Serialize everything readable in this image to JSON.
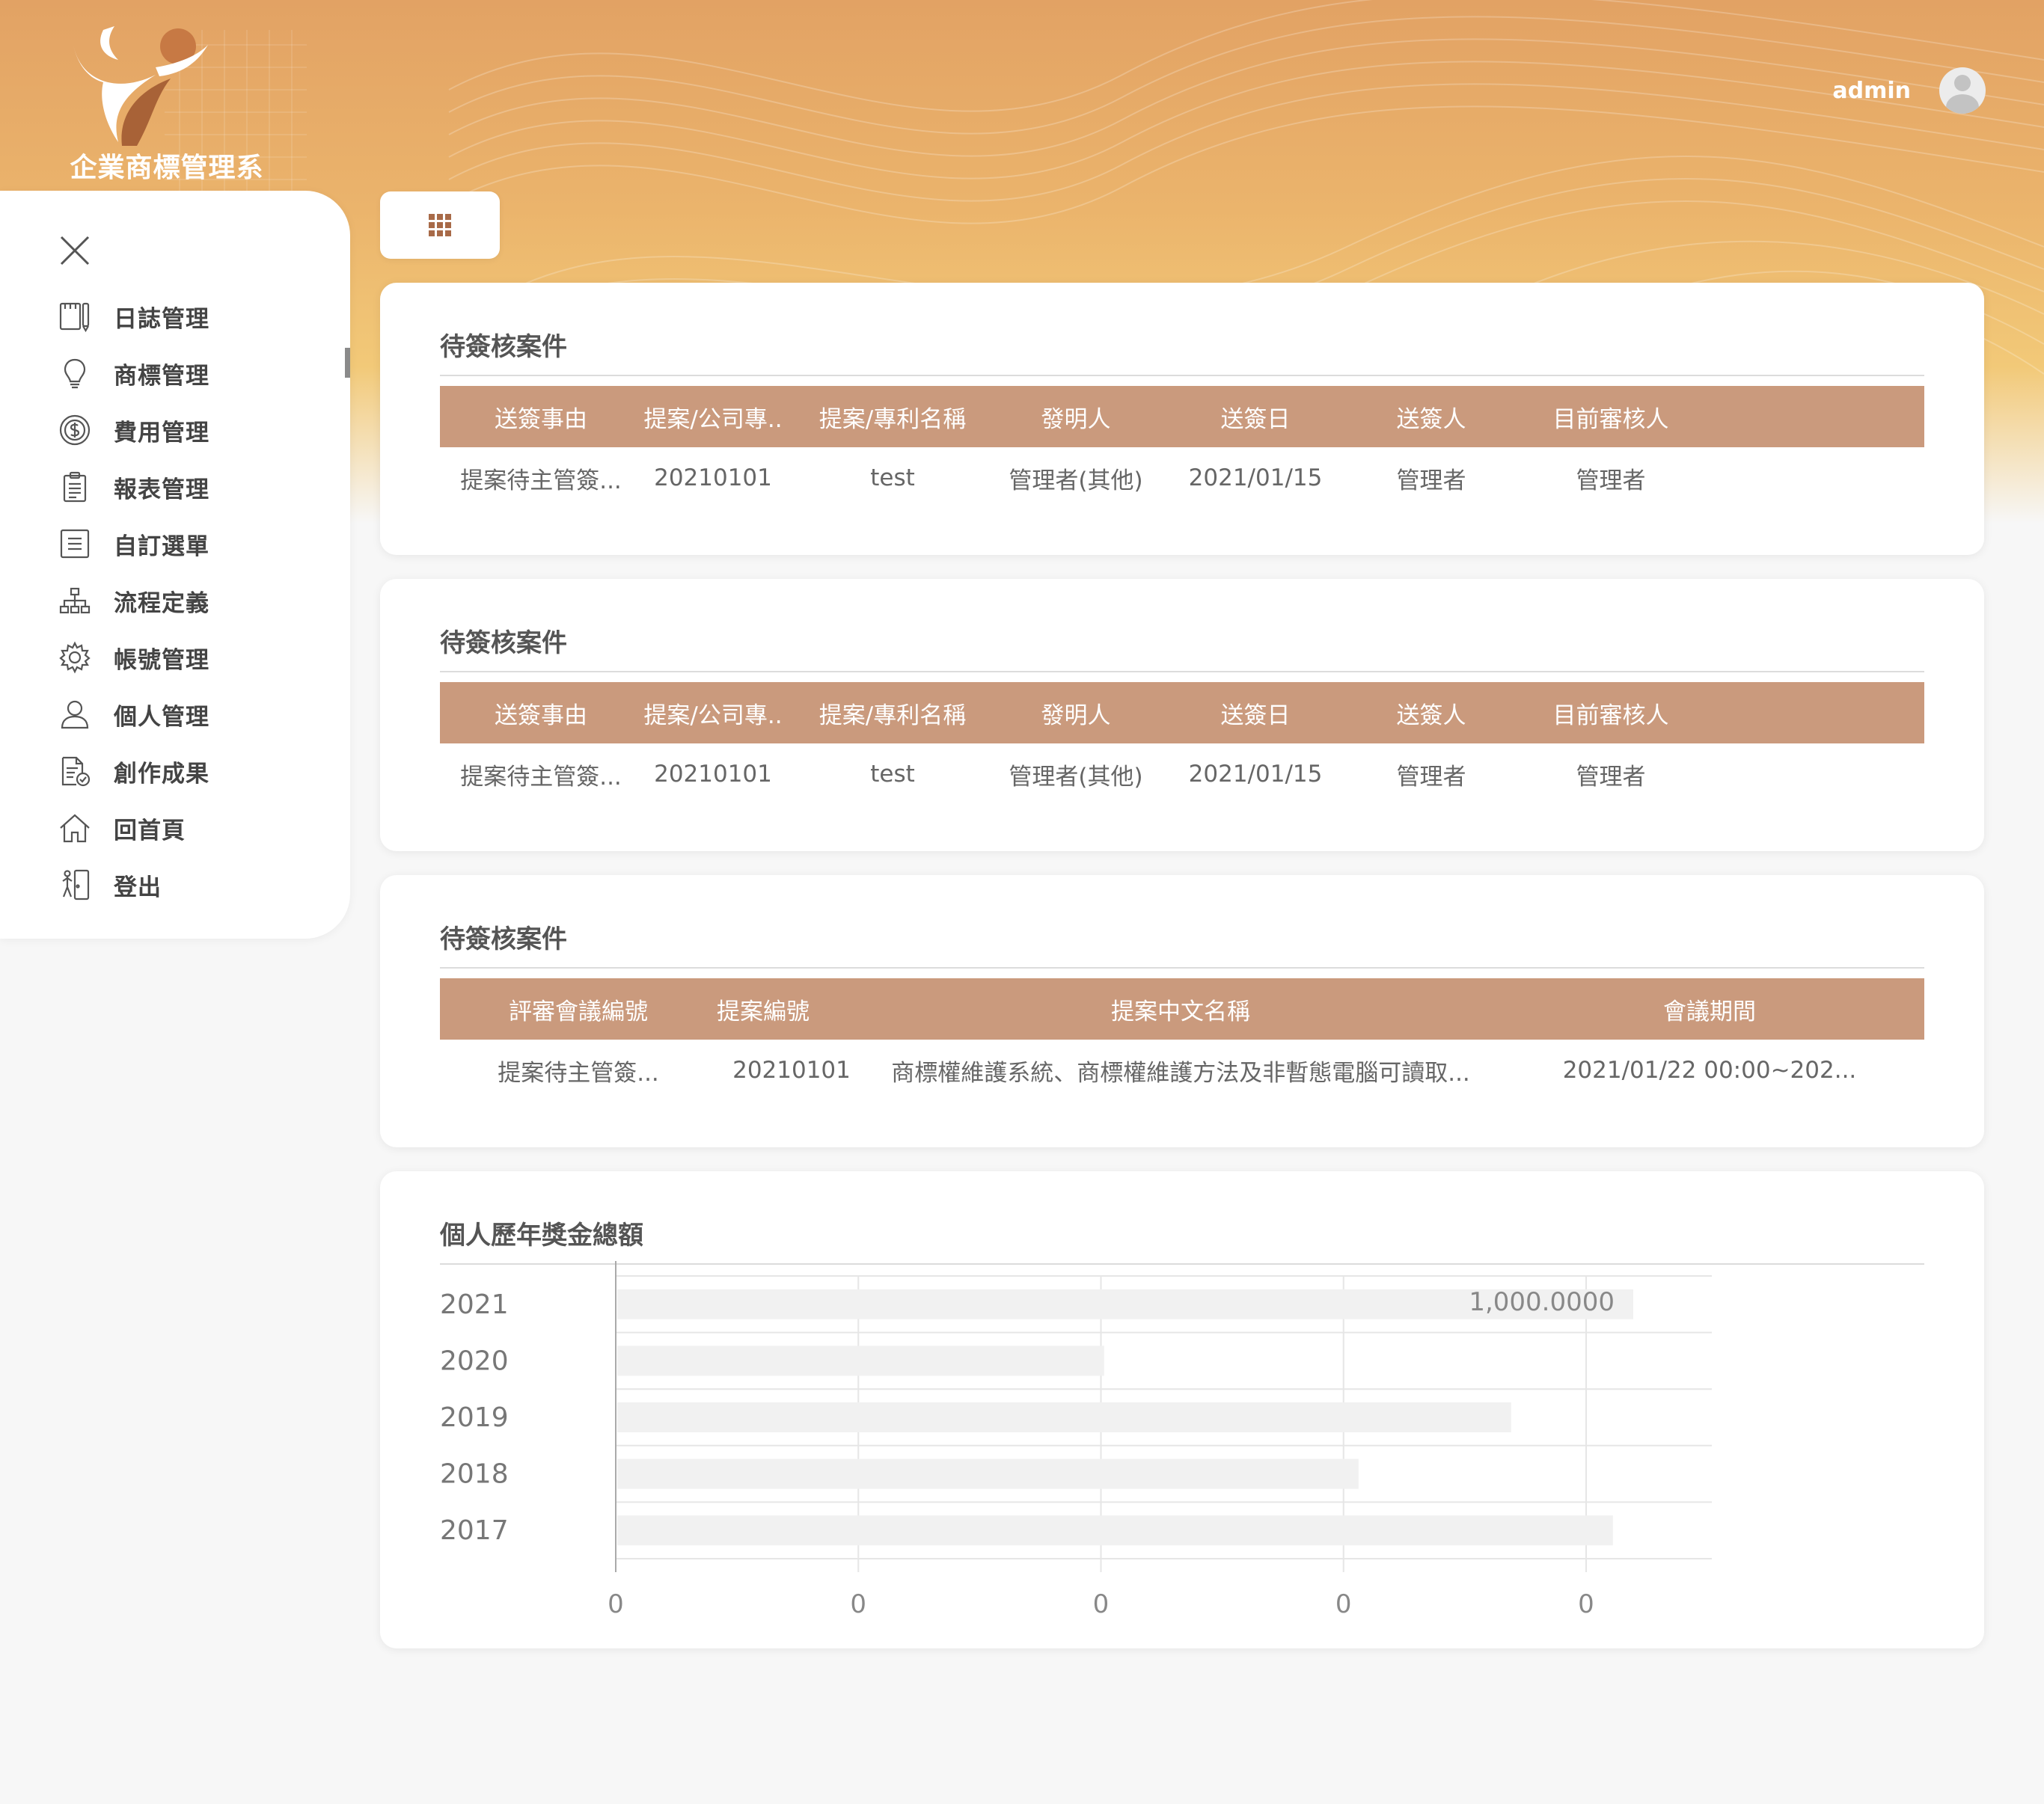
{
  "app": {
    "title": "企業商標管理系統"
  },
  "user": {
    "name": "admin"
  },
  "menu": [
    {
      "label": "日誌管理",
      "icon": "log-icon"
    },
    {
      "label": "商標管理",
      "icon": "lightbulb-icon"
    },
    {
      "label": "費用管理",
      "icon": "dollar-coin-icon"
    },
    {
      "label": "報表管理",
      "icon": "clipboard-icon"
    },
    {
      "label": "自訂選單",
      "icon": "list-icon"
    },
    {
      "label": "流程定義",
      "icon": "org-chart-icon"
    },
    {
      "label": "帳號管理",
      "icon": "gear-icon"
    },
    {
      "label": "個人管理",
      "icon": "user-icon"
    },
    {
      "label": "創作成果",
      "icon": "document-check-icon"
    },
    {
      "label": "回首頁",
      "icon": "home-icon"
    },
    {
      "label": "登出",
      "icon": "logout-icon"
    }
  ],
  "cards": [
    {
      "title": "待簽核案件",
      "columns": [
        "送簽事由",
        "提案/公司專..",
        "提案/專利名稱",
        "發明人",
        "送簽日",
        "送簽人",
        "目前審核人"
      ],
      "rows": [
        [
          "提案待主管簽...",
          "20210101",
          "test",
          "管理者(其他)",
          "2021/01/15",
          "管理者",
          "管理者"
        ]
      ]
    },
    {
      "title": "待簽核案件",
      "columns": [
        "送簽事由",
        "提案/公司專..",
        "提案/專利名稱",
        "發明人",
        "送簽日",
        "送簽人",
        "目前審核人"
      ],
      "rows": [
        [
          "提案待主管簽...",
          "20210101",
          "test",
          "管理者(其他)",
          "2021/01/15",
          "管理者",
          "管理者"
        ]
      ]
    },
    {
      "title": "待簽核案件",
      "columns": [
        "評審會議編號",
        "提案編號",
        "提案中文名稱",
        "會議期間"
      ],
      "rows": [
        [
          "提案待主管簽...",
          "20210101",
          "商標權維護系統、商標權維護方法及非暫態電腦可讀取...",
          "2021/01/22  00:00~202..."
        ]
      ]
    },
    {
      "title": "個人歷年獎金總額"
    }
  ],
  "chart_data": {
    "type": "bar",
    "orientation": "horizontal",
    "title": "個人歷年獎金總額",
    "categories": [
      "2021",
      "2020",
      "2019",
      "2018",
      "2017"
    ],
    "values": [
      1000,
      480,
      880,
      730,
      980
    ],
    "xlim": [
      0,
      1000
    ],
    "x_tick_labels": [
      "0",
      "0",
      "0",
      "0",
      "0"
    ],
    "data_labels": [
      "1,000.0000",
      "",
      "",
      "",
      ""
    ],
    "bar_color": "#f1f1f1",
    "grid": true
  }
}
